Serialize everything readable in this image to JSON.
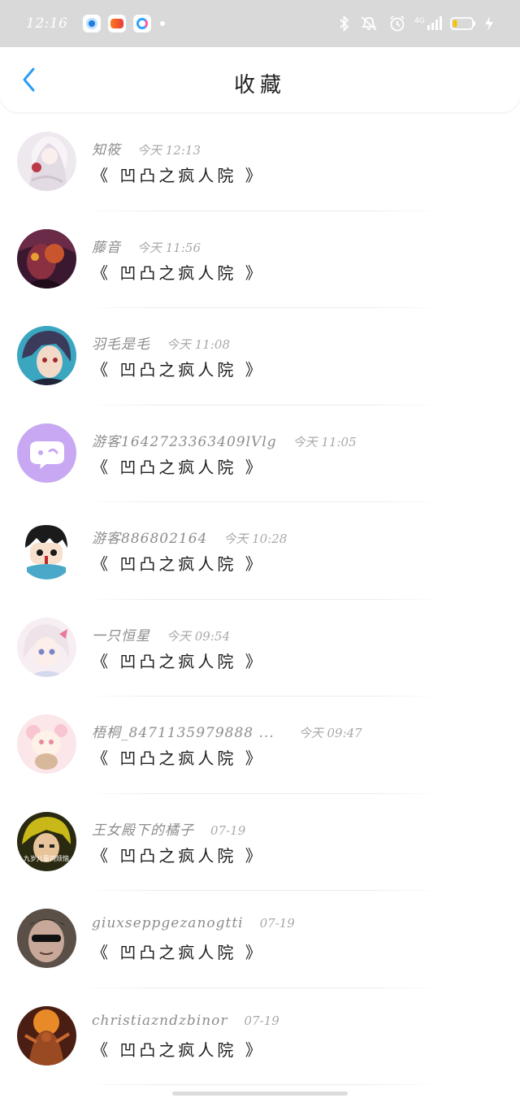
{
  "status_bar": {
    "time": "12:16",
    "apps": [
      "browser-app-icon",
      "game-center-app-icon",
      "cloud-app-icon"
    ],
    "network_label": "4G",
    "icons": [
      "bluetooth-icon",
      "mute-icon",
      "alarm-icon",
      "signal-icon",
      "battery-icon",
      "charging-icon"
    ]
  },
  "header": {
    "title": "收藏",
    "back_icon": "chevron-left-icon"
  },
  "items": [
    {
      "name": "知筱",
      "time": "今天 12:13",
      "book": "《 凹凸之疯人院 》"
    },
    {
      "name": "藤音",
      "time": "今天 11:56",
      "book": "《 凹凸之疯人院 》"
    },
    {
      "name": "羽毛是毛",
      "time": "今天 11:08",
      "book": "《 凹凸之疯人院 》"
    },
    {
      "name": "游客1642723363409lVlg",
      "time": "今天 11:05",
      "book": "《 凹凸之疯人院 》"
    },
    {
      "name": "游客886802164",
      "time": "今天 10:28",
      "book": "《 凹凸之疯人院 》"
    },
    {
      "name": "一只恒星",
      "time": "今天 09:54",
      "book": "《 凹凸之疯人院 》"
    },
    {
      "name": "梧桐_8471135979888 ...",
      "time": "今天 09:47",
      "book": "《 凹凸之疯人院 》"
    },
    {
      "name": "王女殿下的橘子",
      "time": "07-19",
      "book": "《 凹凸之疯人院 》"
    },
    {
      "name": "giuxseppgezanogtti",
      "time": "07-19",
      "book": "《 凹凸之疯人院 》"
    },
    {
      "name": "christiazndzbinor",
      "time": "07-19",
      "book": "《 凹凸之疯人院 》"
    }
  ],
  "avatar_overlay_text": "九岁儿童的烦恼",
  "colors": {
    "accent": "#2a9df4",
    "status_bar_bg": "#d9d9d9",
    "name_text": "#8d8d8d",
    "time_text": "#a9a9a9",
    "book_text": "#1d1d1d"
  }
}
